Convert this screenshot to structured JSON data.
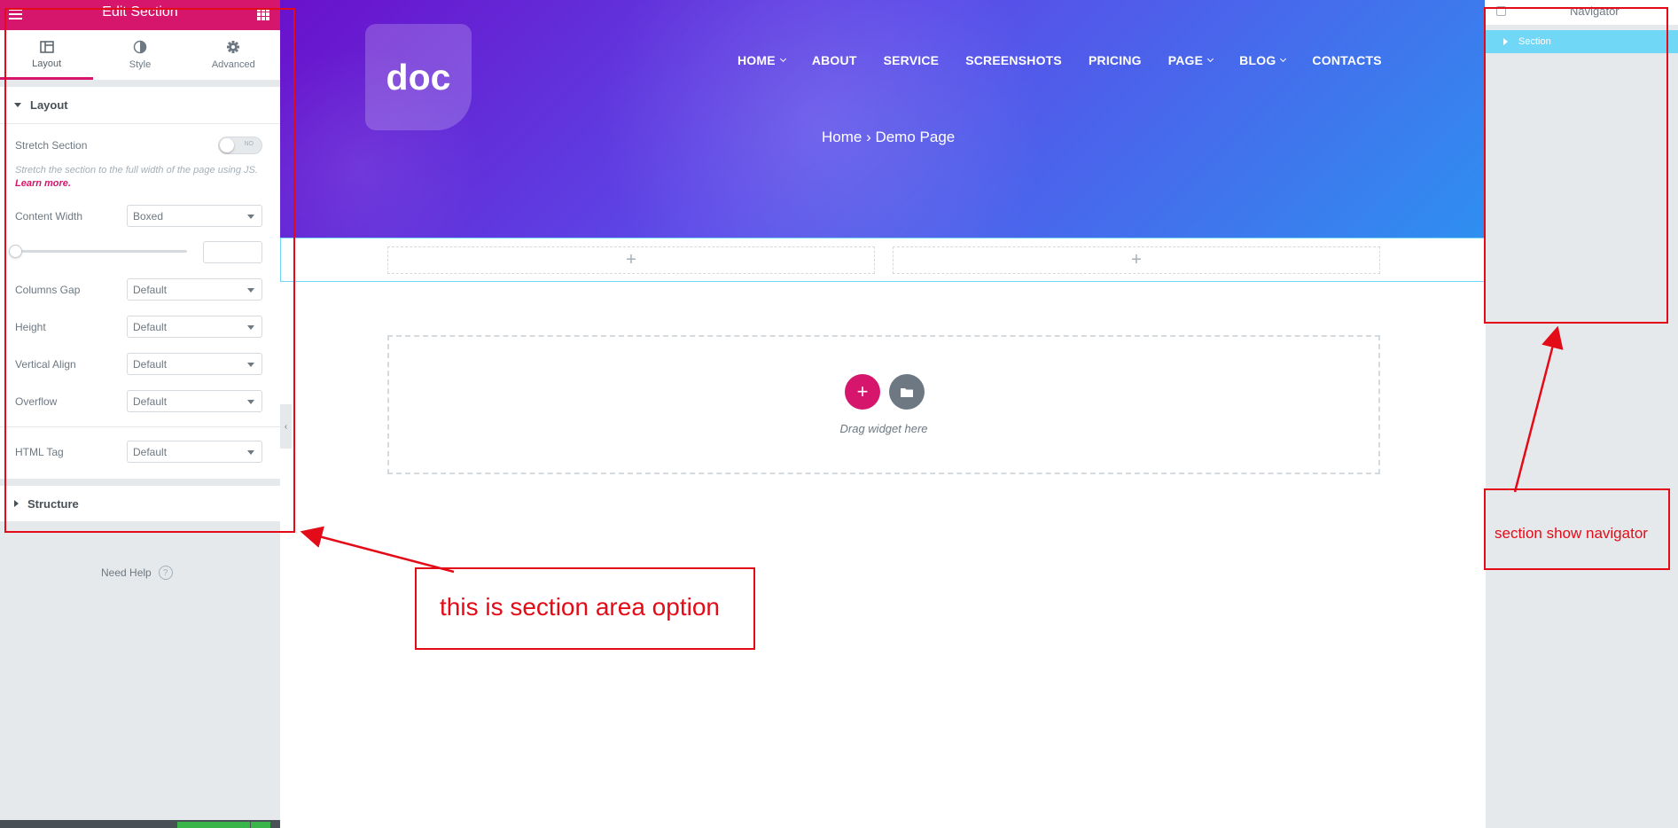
{
  "panel": {
    "header_title": "Edit Section",
    "tabs": [
      {
        "label": "Layout",
        "icon": "layout-icon"
      },
      {
        "label": "Style",
        "icon": "style-icon"
      },
      {
        "label": "Advanced",
        "icon": "gear-icon"
      }
    ],
    "layout_section_title": "Layout",
    "stretch_label": "Stretch Section",
    "stretch_toggle_text": "NO",
    "stretch_desc": "Stretch the section to the full width of the page using JS.",
    "learn_more": "Learn more.",
    "content_width_label": "Content Width",
    "content_width_value": "Boxed",
    "columns_gap_label": "Columns Gap",
    "columns_gap_value": "Default",
    "height_label": "Height",
    "height_value": "Default",
    "vertical_align_label": "Vertical Align",
    "vertical_align_value": "Default",
    "overflow_label": "Overflow",
    "overflow_value": "Default",
    "html_tag_label": "HTML Tag",
    "html_tag_value": "Default",
    "structure_title": "Structure",
    "need_help": "Need Help",
    "need_help_icon": "?"
  },
  "hero": {
    "logo_text": "doc",
    "nav": [
      {
        "label": "HOME",
        "dropdown": true
      },
      {
        "label": "ABOUT",
        "dropdown": false
      },
      {
        "label": "SERVICE",
        "dropdown": false
      },
      {
        "label": "SCREENSHOTS",
        "dropdown": false
      },
      {
        "label": "PRICING",
        "dropdown": false
      },
      {
        "label": "PAGE",
        "dropdown": true
      },
      {
        "label": "BLOG",
        "dropdown": true
      },
      {
        "label": "CONTACTS",
        "dropdown": false
      }
    ],
    "breadcrumb": "Home › Demo Page"
  },
  "canvas": {
    "column_placeholder": "+",
    "add_button": "+",
    "drag_text": "Drag widget here"
  },
  "navigator": {
    "title": "Navigator",
    "section_label": "Section"
  },
  "annotations": {
    "section_area": "this is section area option",
    "navigator_note": "section show navigator"
  },
  "colors": {
    "accent": "#d5166c",
    "navigator_selected": "#71d7f7",
    "annotation_red": "#e30b17",
    "hero_gradient_start": "#6a11cb",
    "hero_gradient_end": "#2f8ff0"
  }
}
